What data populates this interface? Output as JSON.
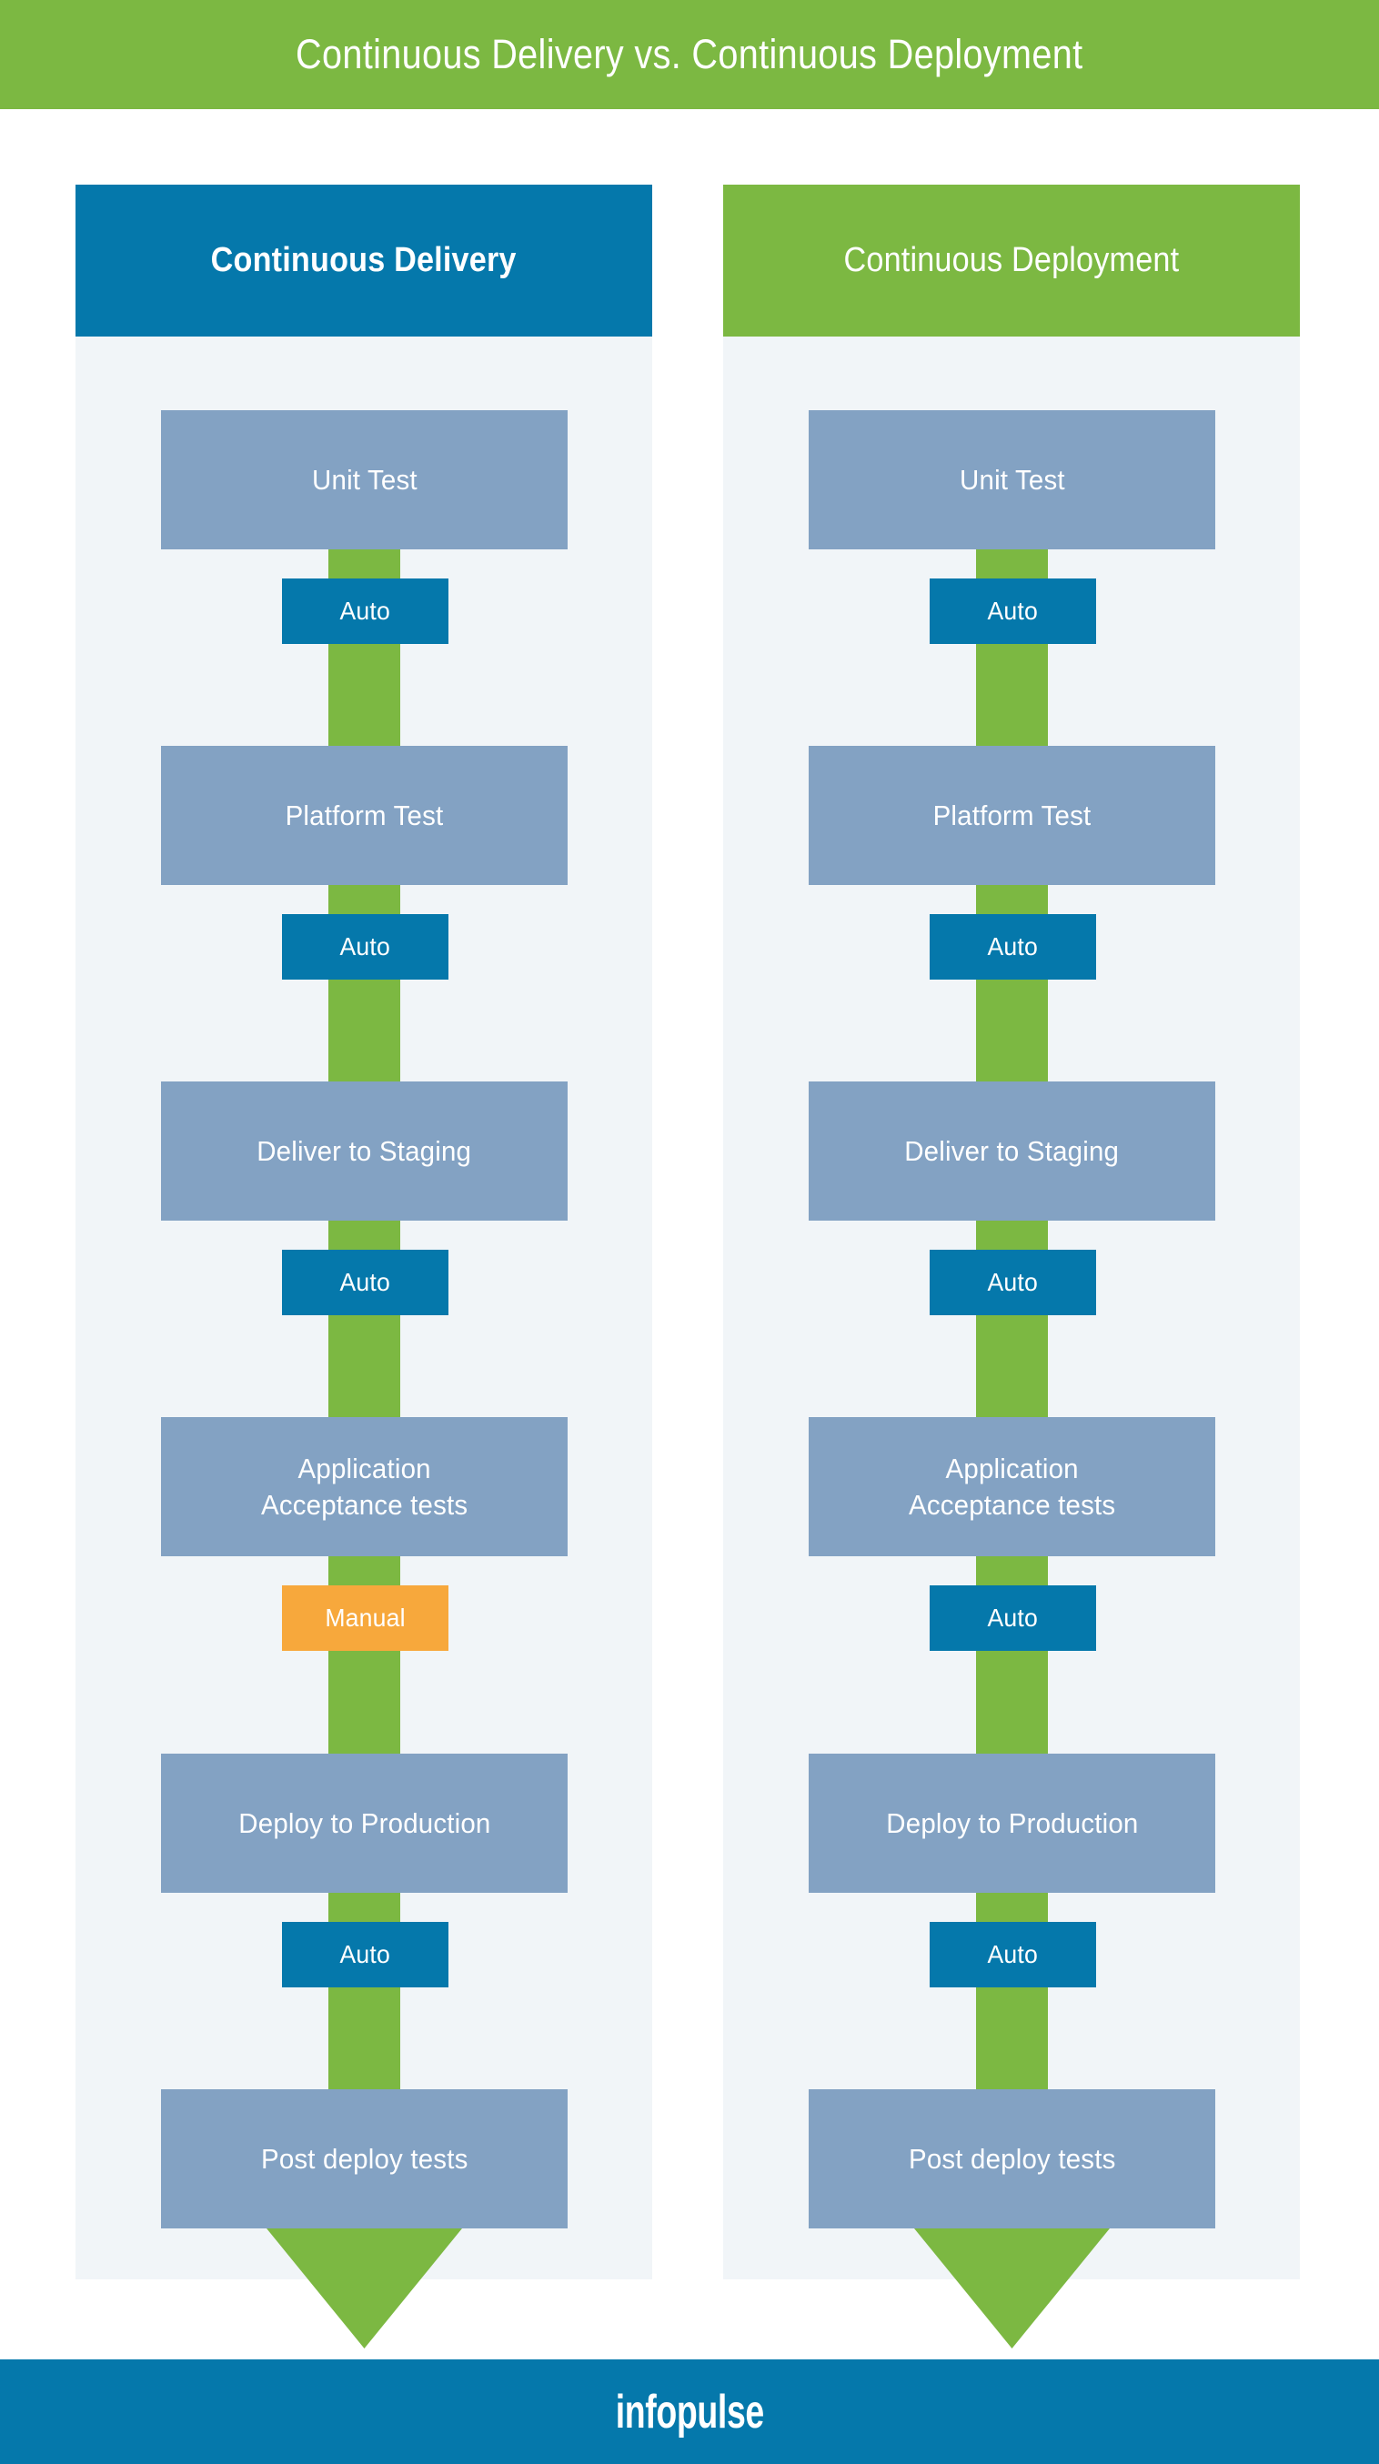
{
  "banner": {
    "title": "Continuous Delivery vs. Continuous Deployment",
    "background_color": "#7cb842",
    "text_color": "#ffffff"
  },
  "theme": {
    "green": "#7cb842",
    "blue": "#0578ab",
    "step_blue": "#83a2c3",
    "orange": "#f7a83c",
    "panel_bg": "#f1f5f8",
    "page_bg": "#ffffff",
    "text_on_color": "#ffffff"
  },
  "columns": [
    {
      "id": "continuous-delivery",
      "header": {
        "title": "Continuous Delivery",
        "background_color": "#0578ab"
      },
      "pipeline": [
        {
          "kind": "step",
          "label": "Unit Test"
        },
        {
          "kind": "gate",
          "label": "Auto",
          "mode": "auto"
        },
        {
          "kind": "step",
          "label": "Platform Test"
        },
        {
          "kind": "gate",
          "label": "Auto",
          "mode": "auto"
        },
        {
          "kind": "step",
          "label": "Deliver to Staging"
        },
        {
          "kind": "gate",
          "label": "Auto",
          "mode": "auto"
        },
        {
          "kind": "step",
          "label": "Application\nAcceptance tests"
        },
        {
          "kind": "gate",
          "label": "Manual",
          "mode": "manual"
        },
        {
          "kind": "step",
          "label": "Deploy to Production"
        },
        {
          "kind": "gate",
          "label": "Auto",
          "mode": "auto"
        },
        {
          "kind": "step",
          "label": "Post deploy tests"
        }
      ]
    },
    {
      "id": "continuous-deployment",
      "header": {
        "title": "Continuous Deployment",
        "background_color": "#7cb842"
      },
      "pipeline": [
        {
          "kind": "step",
          "label": "Unit Test"
        },
        {
          "kind": "gate",
          "label": "Auto",
          "mode": "auto"
        },
        {
          "kind": "step",
          "label": "Platform Test"
        },
        {
          "kind": "gate",
          "label": "Auto",
          "mode": "auto"
        },
        {
          "kind": "step",
          "label": "Deliver to Staging"
        },
        {
          "kind": "gate",
          "label": "Auto",
          "mode": "auto"
        },
        {
          "kind": "step",
          "label": "Application\nAcceptance tests"
        },
        {
          "kind": "gate",
          "label": "Auto",
          "mode": "auto"
        },
        {
          "kind": "step",
          "label": "Deploy to Production"
        },
        {
          "kind": "gate",
          "label": "Auto",
          "mode": "auto"
        },
        {
          "kind": "step",
          "label": "Post deploy tests"
        }
      ]
    }
  ],
  "layout": {
    "step_tops": [
      292,
      477,
      662,
      847,
      1032,
      1217
    ],
    "gate_tops": [
      410,
      595,
      780,
      965,
      1150
    ],
    "arrow_icon": "down-arrow-icon"
  },
  "footer": {
    "logo_text": "infopulse",
    "background_color": "#0578ab"
  }
}
